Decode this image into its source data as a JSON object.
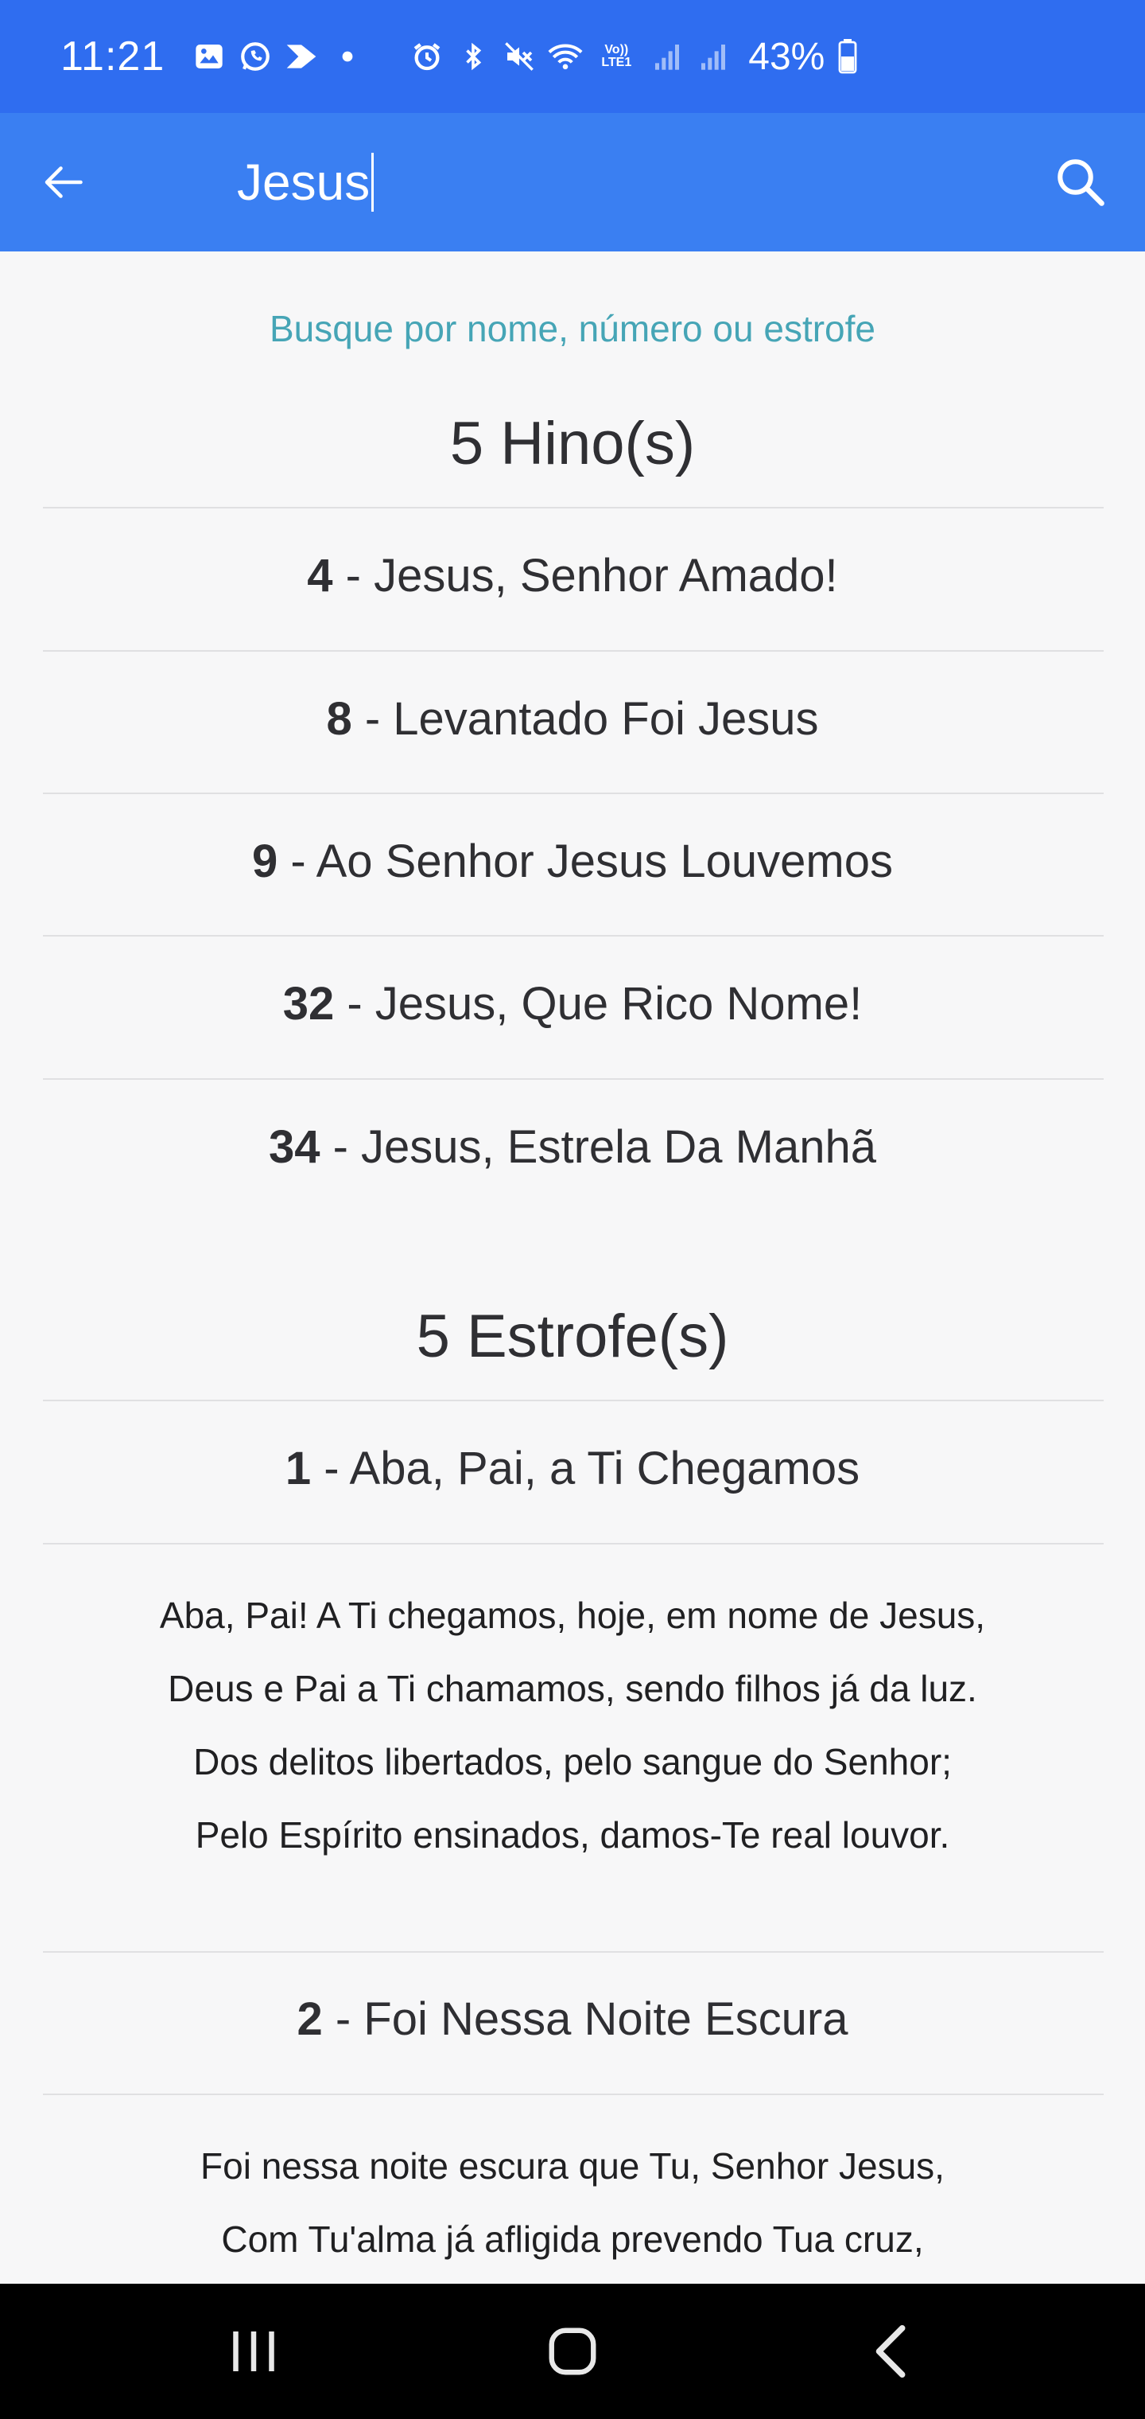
{
  "status_bar": {
    "time": "11:21",
    "battery": "43%",
    "left_icons": [
      "gallery-icon",
      "whatsapp-icon",
      "cast-icon",
      "dot-icon"
    ],
    "right_icons": [
      "alarm-icon",
      "bluetooth-icon",
      "mute-icon",
      "wifi-icon",
      "volte-icon",
      "signal-icon",
      "signal-icon",
      "battery-icon"
    ],
    "volte_label": "Vo)) LTE1"
  },
  "app_bar": {
    "search_value": "Jesus",
    "colors": {
      "status": "#2f6df0",
      "bar": "#3a7ff2"
    }
  },
  "hint": "Busque por nome, número ou estrofe",
  "hymns": {
    "title": "5 Hino(s)",
    "items": [
      {
        "number": "4",
        "title": " - Jesus, Senhor Amado!"
      },
      {
        "number": "8",
        "title": " - Levantado Foi Jesus"
      },
      {
        "number": "9",
        "title": " - Ao Senhor Jesus Louvemos"
      },
      {
        "number": "32",
        "title": " - Jesus, Que Rico Nome!"
      },
      {
        "number": "34",
        "title": " - Jesus, Estrela Da Manhã"
      }
    ]
  },
  "stanzas": {
    "title": "5 Estrofe(s)",
    "items": [
      {
        "number": "1",
        "title": " - Aba, Pai, a Ti Chegamos",
        "lines": [
          "Aba, Pai! A Ti chegamos, hoje, em nome de Jesus,",
          "Deus e Pai a Ti chamamos, sendo filhos já da luz.",
          "Dos delitos libertados, pelo sangue do Senhor;",
          "Pelo Espírito ensinados, damos-Te real louvor."
        ]
      },
      {
        "number": "2",
        "title": " - Foi Nessa Noite Escura",
        "lines": [
          "Foi nessa noite escura que Tu, Senhor Jesus,",
          "Com Tu'alma já afligida prevendo Tua cruz,"
        ]
      }
    ]
  }
}
